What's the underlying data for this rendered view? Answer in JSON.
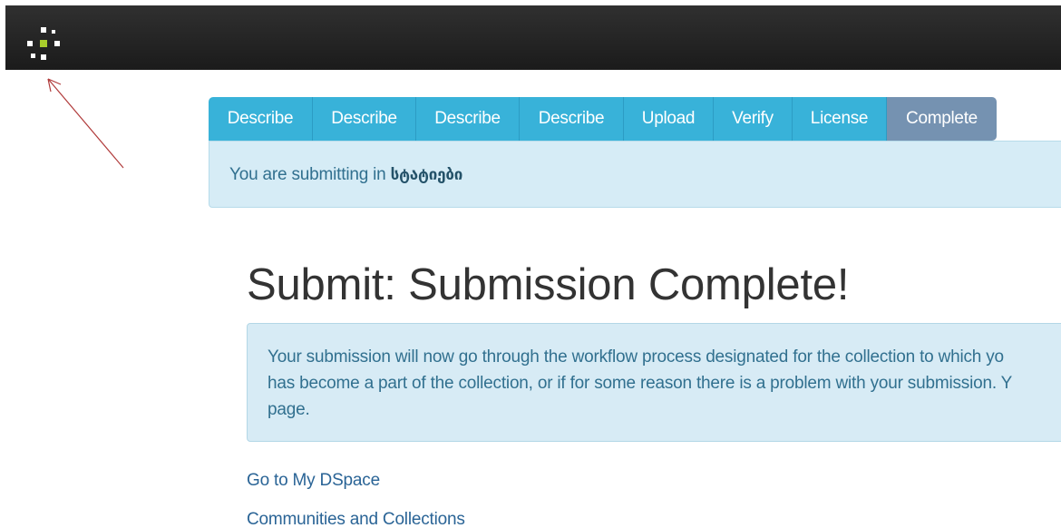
{
  "navbar": {
    "logo_icon": "dspace-logo-icon",
    "accent_color": "#a9cd2c"
  },
  "annotation": {
    "arrow_icon": "red-annotation-arrow-icon",
    "color": "#b03a3a"
  },
  "steps": [
    {
      "label": "Describe",
      "active": false
    },
    {
      "label": "Describe",
      "active": false
    },
    {
      "label": "Describe",
      "active": false
    },
    {
      "label": "Describe",
      "active": false
    },
    {
      "label": "Upload",
      "active": false
    },
    {
      "label": "Verify",
      "active": false
    },
    {
      "label": "License",
      "active": false
    },
    {
      "label": "Complete",
      "active": true
    }
  ],
  "submission_info": {
    "prefix": "You are submitting in ",
    "collection": "სტატიები"
  },
  "page": {
    "title": "Submit: Submission Complete!"
  },
  "alert": {
    "lines": [
      "Your submission will now go through the workflow process designated for the collection to which yo",
      "has become a part of the collection, or if for some reason there is a problem with your submission. Y",
      "page."
    ]
  },
  "links": {
    "my_dspace": "Go to My DSpace",
    "communities": "Communities and Collections"
  },
  "colors": {
    "step_bg": "#38b2d9",
    "step_active_bg": "#7592b1",
    "info_bg": "#d6ecf6",
    "text_info": "#31708f",
    "link": "#2a6496"
  }
}
